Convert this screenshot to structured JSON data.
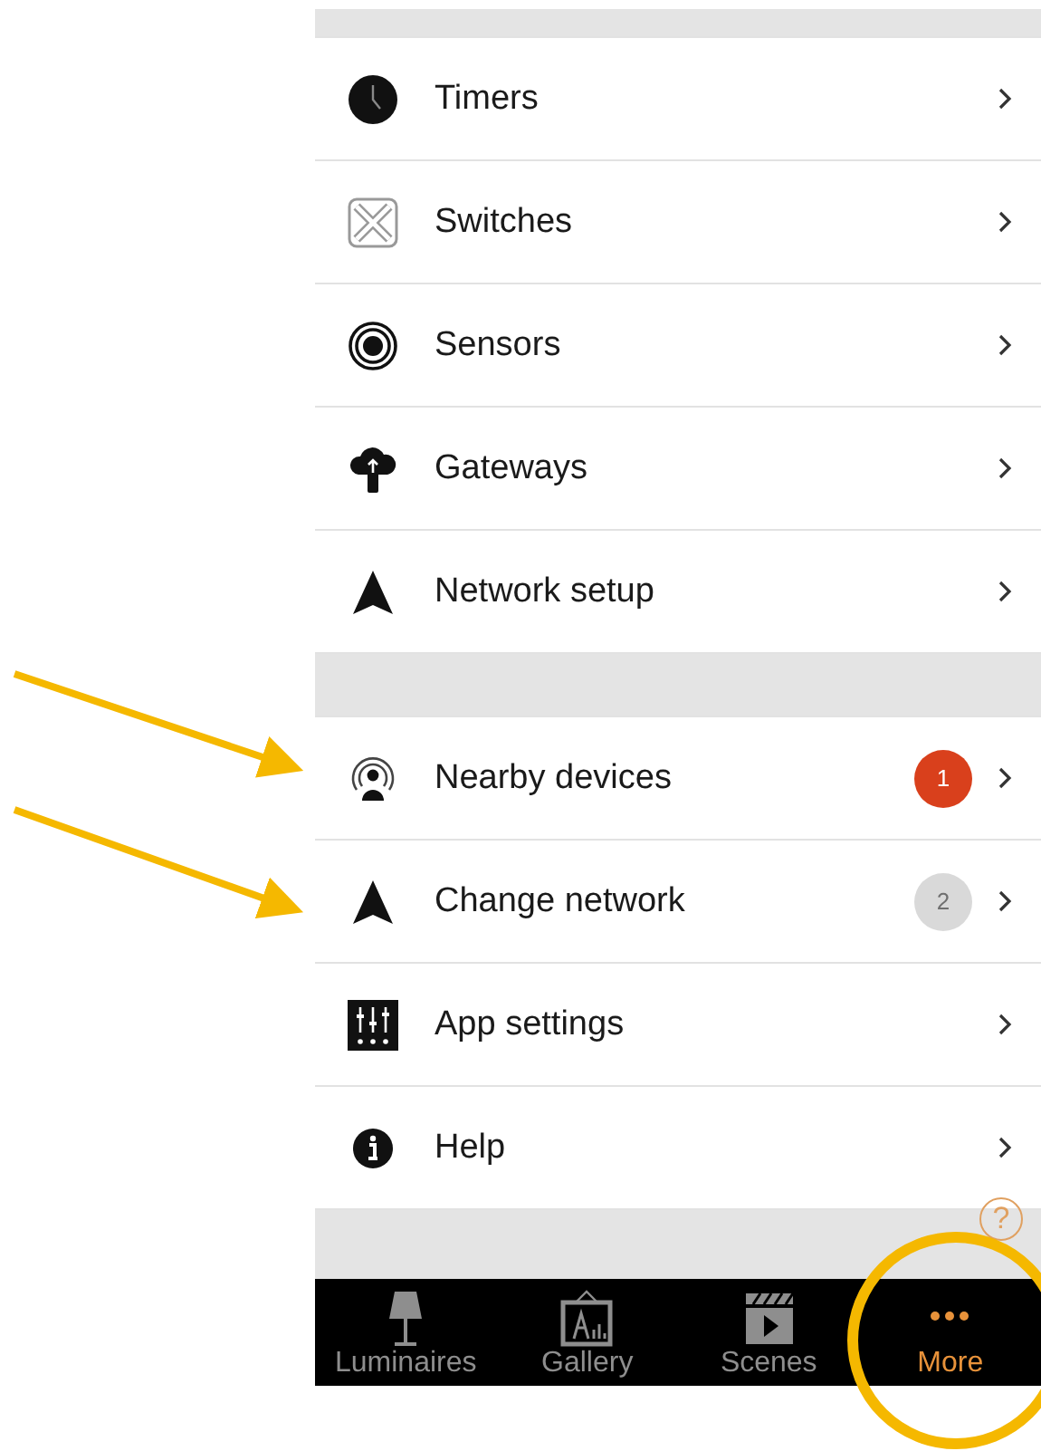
{
  "sections": [
    {
      "items": [
        {
          "label": "Timers"
        },
        {
          "label": "Switches"
        },
        {
          "label": "Sensors"
        },
        {
          "label": "Gateways"
        },
        {
          "label": "Network setup"
        }
      ]
    },
    {
      "items": [
        {
          "label": "Nearby devices",
          "badge": {
            "text": "1",
            "color": "#d9401c"
          }
        },
        {
          "label": "Change network",
          "badge": {
            "text": "2",
            "color": "#d9d9d9"
          }
        },
        {
          "label": "App settings"
        },
        {
          "label": "Help"
        }
      ]
    }
  ],
  "help_button": {
    "label": "?"
  },
  "tabs": [
    {
      "label": "Luminaires",
      "selected": false
    },
    {
      "label": "Gallery",
      "selected": false
    },
    {
      "label": "Scenes",
      "selected": false
    },
    {
      "label": "More",
      "selected": true
    }
  ],
  "annotations": [
    {
      "kind": "arrow"
    },
    {
      "kind": "arrow"
    },
    {
      "kind": "circle"
    }
  ]
}
